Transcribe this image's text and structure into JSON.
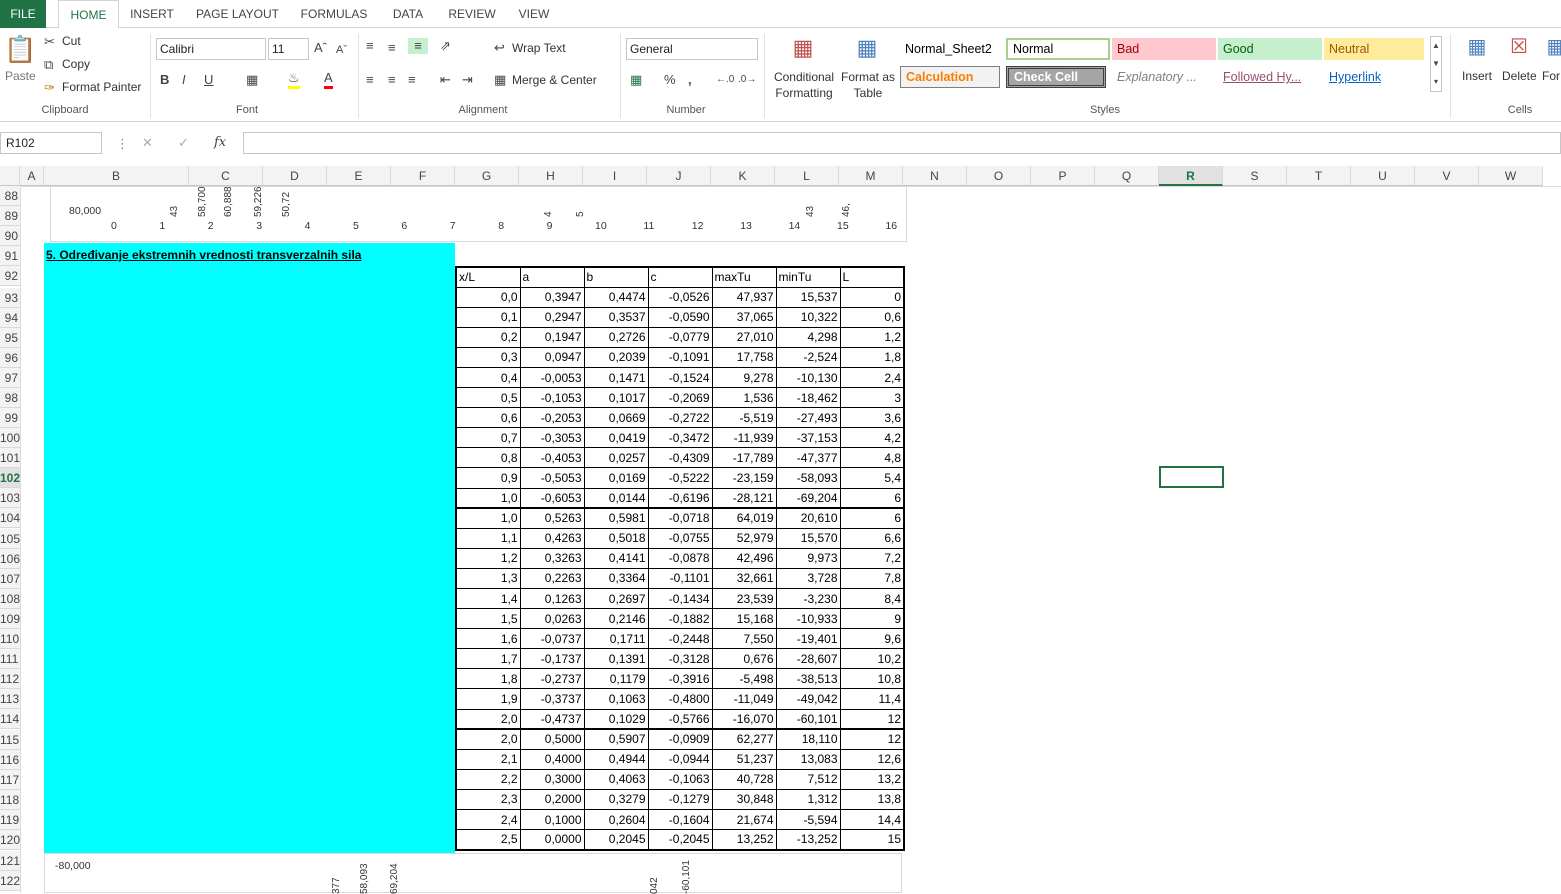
{
  "tabs": [
    "FILE",
    "HOME",
    "INSERT",
    "PAGE LAYOUT",
    "FORMULAS",
    "DATA",
    "REVIEW",
    "VIEW"
  ],
  "clipboard": {
    "paste": "Paste",
    "cut": "Cut",
    "copy": "Copy",
    "format_painter": "Format Painter",
    "label": "Clipboard"
  },
  "font": {
    "name": "Calibri",
    "size": "11",
    "label": "Font",
    "bold": "B",
    "italic": "I",
    "underline": "U"
  },
  "alignment": {
    "wrap": "Wrap Text",
    "merge": "Merge & Center",
    "label": "Alignment"
  },
  "number": {
    "format": "General",
    "label": "Number",
    "percent": "%",
    "comma": ","
  },
  "styles_group": {
    "conditional": "Conditional Formatting",
    "format_table": "Format as Table",
    "label": "Styles",
    "cells": [
      {
        "text": "Normal_Sheet2",
        "bg": "#ffffff",
        "color": "#000000"
      },
      {
        "text": "Normal",
        "bg": "#ffffff",
        "color": "#000000"
      },
      {
        "text": "Bad",
        "bg": "#ffc7ce",
        "color": "#9c0006"
      },
      {
        "text": "Good",
        "bg": "#c6efce",
        "color": "#006100"
      },
      {
        "text": "Neutral",
        "bg": "#ffeb9c",
        "color": "#9c5700"
      },
      {
        "text": "Calculation",
        "bg": "#f2f2f2",
        "color": "#fa7d00"
      },
      {
        "text": "Check Cell",
        "bg": "#a5a5a5",
        "color": "#ffffff"
      },
      {
        "text": "Explanatory ...",
        "bg": "#ffffff",
        "color": "#7f7f7f"
      },
      {
        "text": "Followed Hy...",
        "bg": "#ffffff",
        "color": "#954f72"
      },
      {
        "text": "Hyperlink",
        "bg": "#ffffff",
        "color": "#0563c1"
      }
    ]
  },
  "cells_group": {
    "insert": "Insert",
    "delete": "Delete",
    "format": "For",
    "label": "Cells"
  },
  "namebox": "R102",
  "fx": "fx",
  "columns": [
    {
      "l": "A",
      "x": 20,
      "w": 24
    },
    {
      "l": "B",
      "x": 44,
      "w": 145
    },
    {
      "l": "C",
      "x": 189,
      "w": 74
    },
    {
      "l": "D",
      "x": 263,
      "w": 64
    },
    {
      "l": "E",
      "x": 327,
      "w": 64
    },
    {
      "l": "F",
      "x": 391,
      "w": 64
    },
    {
      "l": "G",
      "x": 455,
      "w": 64
    },
    {
      "l": "H",
      "x": 519,
      "w": 64
    },
    {
      "l": "I",
      "x": 583,
      "w": 64
    },
    {
      "l": "J",
      "x": 647,
      "w": 64
    },
    {
      "l": "K",
      "x": 711,
      "w": 64
    },
    {
      "l": "L",
      "x": 775,
      "w": 64
    },
    {
      "l": "M",
      "x": 839,
      "w": 64
    },
    {
      "l": "N",
      "x": 903,
      "w": 64
    },
    {
      "l": "O",
      "x": 967,
      "w": 64
    },
    {
      "l": "P",
      "x": 1031,
      "w": 64
    },
    {
      "l": "Q",
      "x": 1095,
      "w": 64
    },
    {
      "l": "R",
      "x": 1159,
      "w": 64
    },
    {
      "l": "S",
      "x": 1223,
      "w": 64
    },
    {
      "l": "T",
      "x": 1287,
      "w": 64
    },
    {
      "l": "U",
      "x": 1351,
      "w": 64
    },
    {
      "l": "V",
      "x": 1415,
      "w": 64
    },
    {
      "l": "W",
      "x": 1479,
      "w": 64
    }
  ],
  "selected_column": "R",
  "rows": [
    88,
    89,
    90,
    91,
    92,
    93,
    94,
    95,
    96,
    97,
    98,
    99,
    100,
    101,
    102,
    103,
    104,
    105,
    106,
    107,
    108,
    109,
    110,
    111,
    112,
    113,
    114,
    115,
    116,
    117,
    118,
    119,
    120,
    121,
    122
  ],
  "selected_row": 102,
  "section_heading": "5. Određivanje ekstremnih vrednosti transverzalnih sila",
  "table": {
    "headers": [
      "x/L",
      "a",
      "b",
      "c",
      "maxTu",
      "minTu",
      "L"
    ],
    "rows": [
      [
        "0,0",
        "0,3947",
        "0,4474",
        "-0,0526",
        "47,937",
        "15,537",
        "0"
      ],
      [
        "0,1",
        "0,2947",
        "0,3537",
        "-0,0590",
        "37,065",
        "10,322",
        "0,6"
      ],
      [
        "0,2",
        "0,1947",
        "0,2726",
        "-0,0779",
        "27,010",
        "4,298",
        "1,2"
      ],
      [
        "0,3",
        "0,0947",
        "0,2039",
        "-0,1091",
        "17,758",
        "-2,524",
        "1,8"
      ],
      [
        "0,4",
        "-0,0053",
        "0,1471",
        "-0,1524",
        "9,278",
        "-10,130",
        "2,4"
      ],
      [
        "0,5",
        "-0,1053",
        "0,1017",
        "-0,2069",
        "1,536",
        "-18,462",
        "3"
      ],
      [
        "0,6",
        "-0,2053",
        "0,0669",
        "-0,2722",
        "-5,519",
        "-27,493",
        "3,6"
      ],
      [
        "0,7",
        "-0,3053",
        "0,0419",
        "-0,3472",
        "-11,939",
        "-37,153",
        "4,2"
      ],
      [
        "0,8",
        "-0,4053",
        "0,0257",
        "-0,4309",
        "-17,789",
        "-47,377",
        "4,8"
      ],
      [
        "0,9",
        "-0,5053",
        "0,0169",
        "-0,5222",
        "-23,159",
        "-58,093",
        "5,4"
      ],
      [
        "1,0",
        "-0,6053",
        "0,0144",
        "-0,6196",
        "-28,121",
        "-69,204",
        "6"
      ],
      [
        "1,0",
        "0,5263",
        "0,5981",
        "-0,0718",
        "64,019",
        "20,610",
        "6"
      ],
      [
        "1,1",
        "0,4263",
        "0,5018",
        "-0,0755",
        "52,979",
        "15,570",
        "6,6"
      ],
      [
        "1,2",
        "0,3263",
        "0,4141",
        "-0,0878",
        "42,496",
        "9,973",
        "7,2"
      ],
      [
        "1,3",
        "0,2263",
        "0,3364",
        "-0,1101",
        "32,661",
        "3,728",
        "7,8"
      ],
      [
        "1,4",
        "0,1263",
        "0,2697",
        "-0,1434",
        "23,539",
        "-3,230",
        "8,4"
      ],
      [
        "1,5",
        "0,0263",
        "0,2146",
        "-0,1882",
        "15,168",
        "-10,933",
        "9"
      ],
      [
        "1,6",
        "-0,0737",
        "0,1711",
        "-0,2448",
        "7,550",
        "-19,401",
        "9,6"
      ],
      [
        "1,7",
        "-0,1737",
        "0,1391",
        "-0,3128",
        "0,676",
        "-28,607",
        "10,2"
      ],
      [
        "1,8",
        "-0,2737",
        "0,1179",
        "-0,3916",
        "-5,498",
        "-38,513",
        "10,8"
      ],
      [
        "1,9",
        "-0,3737",
        "0,1063",
        "-0,4800",
        "-11,049",
        "-49,042",
        "11,4"
      ],
      [
        "2,0",
        "-0,4737",
        "0,1029",
        "-0,5766",
        "-16,070",
        "-60,101",
        "12"
      ],
      [
        "2,0",
        "0,5000",
        "0,5907",
        "-0,0909",
        "62,277",
        "18,110",
        "12"
      ],
      [
        "2,1",
        "0,4000",
        "0,4944",
        "-0,0944",
        "51,237",
        "13,083",
        "12,6"
      ],
      [
        "2,2",
        "0,3000",
        "0,4063",
        "-0,1063",
        "40,728",
        "7,512",
        "13,2"
      ],
      [
        "2,3",
        "0,2000",
        "0,3279",
        "-0,1279",
        "30,848",
        "1,312",
        "13,8"
      ],
      [
        "2,4",
        "0,1000",
        "0,2604",
        "-0,1604",
        "21,674",
        "-5,594",
        "14,4"
      ],
      [
        "2,5",
        "0,0000",
        "0,2045",
        "-0,2045",
        "13,252",
        "-13,252",
        "15"
      ]
    ]
  },
  "chart_top": {
    "y_label": "80,000",
    "x_ticks": [
      "0",
      "1",
      "2",
      "3",
      "4",
      "5",
      "6",
      "7",
      "8",
      "9",
      "10",
      "11",
      "12",
      "13",
      "14",
      "15",
      "16"
    ],
    "value_labels": [
      "43",
      "58,700",
      "60,888",
      "59,226",
      "50,72",
      "4",
      "5",
      "43",
      "46,"
    ]
  },
  "chart_bottom": {
    "y_label": "-80,000",
    "value_labels": [
      "377",
      "58,093",
      "69,204",
      "042",
      "-60,101"
    ]
  }
}
